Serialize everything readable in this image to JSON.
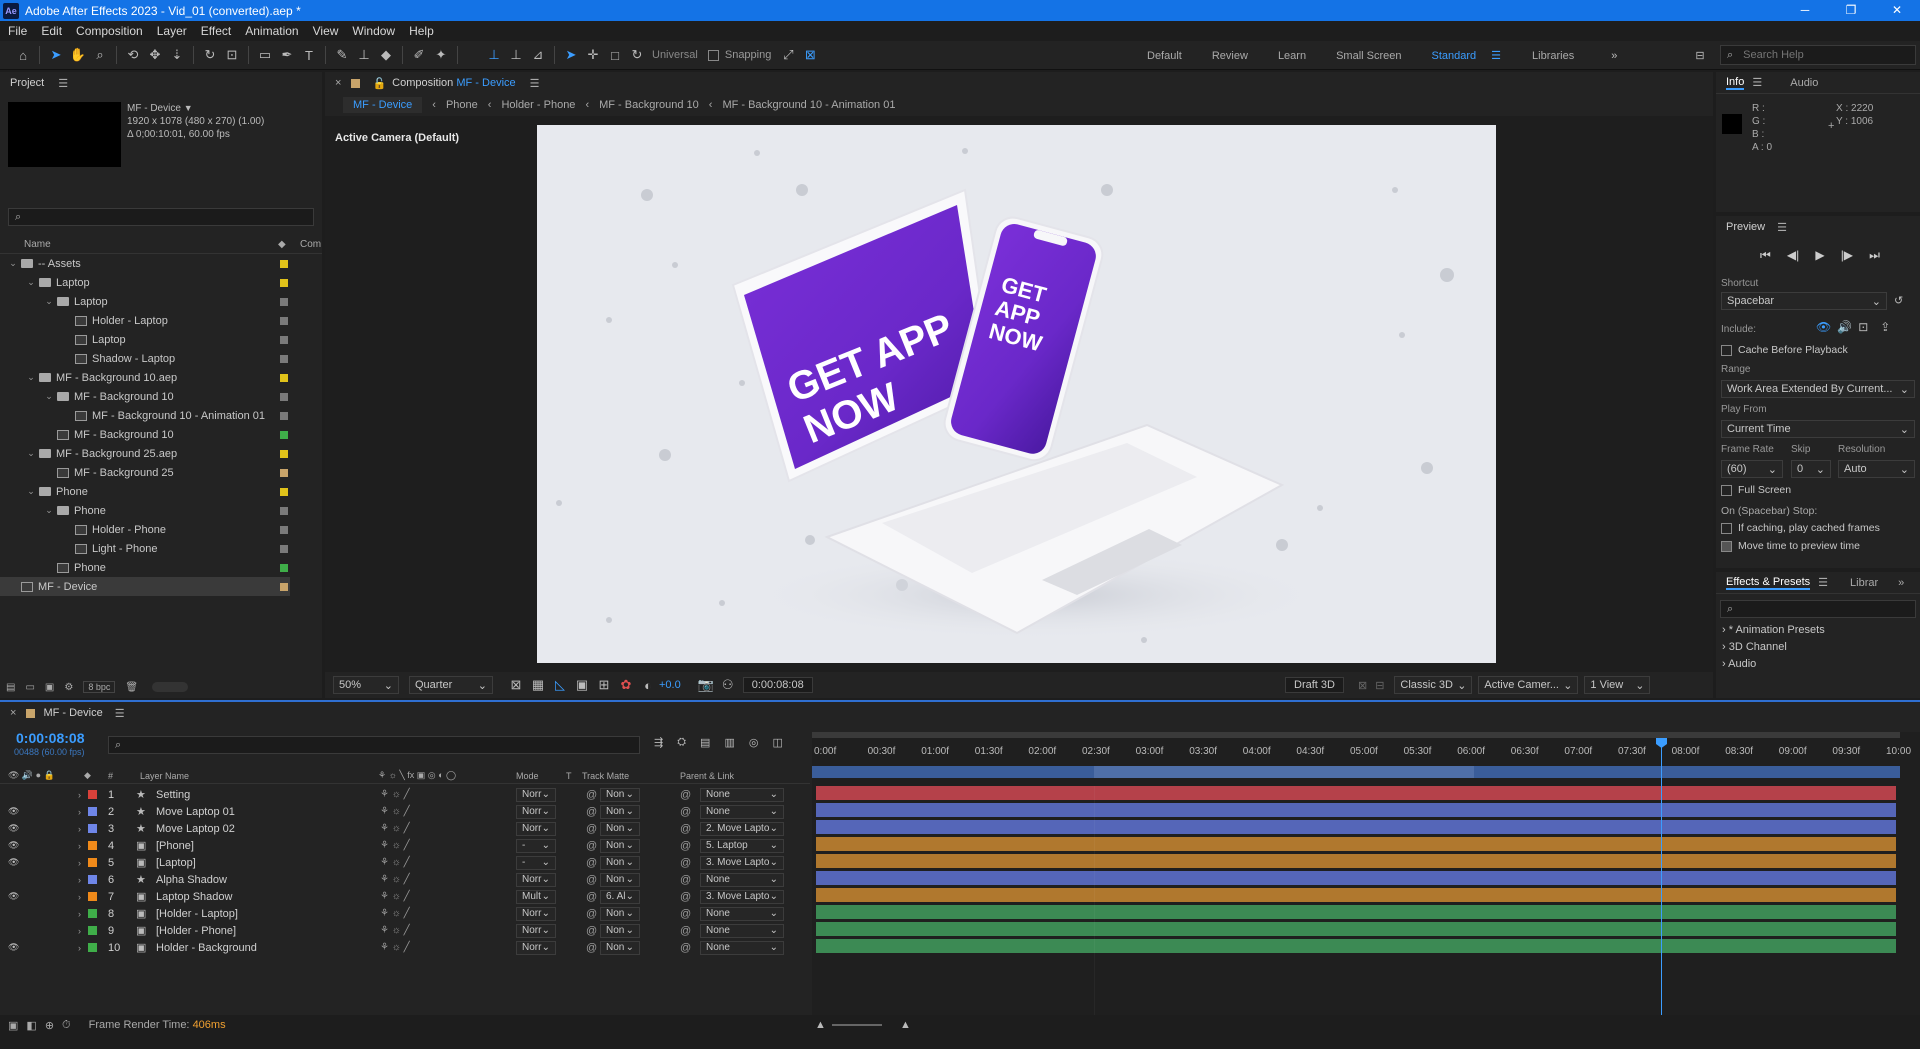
{
  "titlebar": {
    "logo": "Ae",
    "title": "Adobe After Effects 2023 - Vid_01 (converted).aep *",
    "min": "─",
    "max": "❐",
    "close": "✕"
  },
  "menu": [
    "File",
    "Edit",
    "Composition",
    "Layer",
    "Effect",
    "Animation",
    "View",
    "Window",
    "Help"
  ],
  "toolbar": {
    "axis_mode": "Universal",
    "snapping": "Snapping",
    "workspaces": [
      "Default",
      "Review",
      "Learn",
      "Small Screen",
      "Standard",
      "Libraries"
    ],
    "active_workspace": "Standard",
    "search_placeholder": "Search Help"
  },
  "project": {
    "title": "Project",
    "selected_name": "MF - Device",
    "selected_info1": "1920 x 1078  (480 x 270) (1.00)",
    "selected_info2": "Δ 0;00:10:01, 60.00 fps",
    "col_name": "Name",
    "col_comment": "Com",
    "bpc": "8 bpc",
    "items": [
      {
        "name": "-- Assets",
        "level": 0,
        "type": "folder",
        "color": "#e0c21a",
        "open": true
      },
      {
        "name": "Laptop",
        "level": 1,
        "type": "folder",
        "color": "#e0c21a",
        "open": true
      },
      {
        "name": "Laptop",
        "level": 2,
        "type": "folder",
        "color": "#7a7a7a",
        "open": true
      },
      {
        "name": "Holder - Laptop",
        "level": 3,
        "type": "comp",
        "color": "#7a7a7a"
      },
      {
        "name": "Laptop",
        "level": 3,
        "type": "comp",
        "color": "#7a7a7a"
      },
      {
        "name": "Shadow - Laptop",
        "level": 3,
        "type": "comp",
        "color": "#7a7a7a"
      },
      {
        "name": "MF - Background 10.aep",
        "level": 1,
        "type": "folder",
        "color": "#e0c21a",
        "open": true
      },
      {
        "name": "MF - Background 10",
        "level": 2,
        "type": "folder",
        "color": "#7a7a7a",
        "open": true
      },
      {
        "name": "MF - Background 10 - Animation 01",
        "level": 3,
        "type": "comp",
        "color": "#7a7a7a"
      },
      {
        "name": "MF - Background 10",
        "level": 2,
        "type": "comp",
        "color": "#3fae49"
      },
      {
        "name": "MF - Background 25.aep",
        "level": 1,
        "type": "folder",
        "color": "#e0c21a",
        "open": true
      },
      {
        "name": "MF - Background 25",
        "level": 2,
        "type": "comp",
        "color": "#c8a46a"
      },
      {
        "name": "Phone",
        "level": 1,
        "type": "folder",
        "color": "#e0c21a",
        "open": true
      },
      {
        "name": "Phone",
        "level": 2,
        "type": "folder",
        "color": "#7a7a7a",
        "open": true
      },
      {
        "name": "Holder - Phone",
        "level": 3,
        "type": "comp",
        "color": "#7a7a7a"
      },
      {
        "name": "Light - Phone",
        "level": 3,
        "type": "comp",
        "color": "#7a7a7a"
      },
      {
        "name": "Phone",
        "level": 2,
        "type": "comp",
        "color": "#3fae49"
      },
      {
        "name": "MF - Device",
        "level": 0,
        "type": "comp",
        "color": "#c8a46a",
        "selected": true
      }
    ]
  },
  "comp": {
    "tab_prefix": "Composition",
    "tab_name": "MF - Device",
    "breadcrumbs": [
      "MF - Device",
      "Phone",
      "Holder - Phone",
      "MF - Background 10",
      "MF - Background 10 - Animation 01"
    ],
    "camera_label": "Active Camera (Default)",
    "laptop_text": "GET APP NOW",
    "phone_text": "GET APP NOW",
    "zoom": "50%",
    "resolution": "Quarter",
    "exposure": "+0.0",
    "timecode": "0:00:08:08",
    "draft3d": "Draft 3D",
    "renderer": "Classic 3D",
    "camera": "Active Camer...",
    "views": "1 View"
  },
  "info": {
    "tab": "Info",
    "tab2": "Audio",
    "r": "R :",
    "g": "G :",
    "b": "B :",
    "a": "A : 0",
    "x": "X : 2220",
    "y": "Y : 1006"
  },
  "preview": {
    "title": "Preview",
    "shortcut_label": "Shortcut",
    "shortcut": "Spacebar",
    "include_label": "Include:",
    "cache": "Cache Before Playback",
    "range_label": "Range",
    "range": "Work Area Extended By Current...",
    "playfrom_label": "Play From",
    "playfrom": "Current Time",
    "framerate_label": "Frame Rate",
    "skip_label": "Skip",
    "resolution_label": "Resolution",
    "framerate": "(60)",
    "skip": "0",
    "resolution": "Auto",
    "fullscreen": "Full Screen",
    "stop_label": "On (Spacebar) Stop:",
    "if_caching": "If caching, play cached frames",
    "move_time": "Move time to preview time"
  },
  "effects": {
    "title": "Effects & Presets",
    "tab2": "Librar",
    "items": [
      "* Animation Presets",
      "3D Channel",
      "Audio"
    ]
  },
  "timeline": {
    "tab": "MF - Device",
    "timecode": "0:00:08:08",
    "frames": "00488 (60.00 fps)",
    "headers": {
      "num": "#",
      "name": "Layer Name",
      "mode": "Mode",
      "t": "T",
      "matte": "Track Matte",
      "parent": "Parent & Link"
    },
    "ruler": [
      "0:00f",
      "00:30f",
      "01:00f",
      "01:30f",
      "02:00f",
      "02:30f",
      "03:00f",
      "03:30f",
      "04:00f",
      "04:30f",
      "05:00f",
      "05:30f",
      "06:00f",
      "06:30f",
      "07:00f",
      "07:30f",
      "08:00f",
      "08:30f",
      "09:00f",
      "09:30f",
      "10:00"
    ],
    "layers": [
      {
        "num": "1",
        "name": "Setting",
        "label": "#d9413a",
        "icon": "star",
        "mode": "Norr",
        "matte": "Non",
        "parent": "None",
        "bar": "#b5414a",
        "eye": false
      },
      {
        "num": "2",
        "name": "Move Laptop 01",
        "label": "#6f86e8",
        "icon": "star",
        "mode": "Norr",
        "matte": "Non",
        "parent": "None",
        "bar": "#5566b8",
        "eye": true
      },
      {
        "num": "3",
        "name": "Move Laptop 02",
        "label": "#6f86e8",
        "icon": "star",
        "mode": "Norr",
        "matte": "Non",
        "parent": "2. Move Lapto",
        "bar": "#5566b8",
        "eye": true
      },
      {
        "num": "4",
        "name": "[Phone]",
        "label": "#f08a1a",
        "icon": "comp",
        "mode": "-",
        "matte": "Non",
        "parent": "5. Laptop",
        "bar": "#b0782e",
        "eye": true
      },
      {
        "num": "5",
        "name": "[Laptop]",
        "label": "#f08a1a",
        "icon": "comp",
        "mode": "-",
        "matte": "Non",
        "parent": "3. Move Lapto",
        "bar": "#b0782e",
        "eye": true
      },
      {
        "num": "6",
        "name": "Alpha Shadow",
        "label": "#6f86e8",
        "icon": "star",
        "mode": "Norr",
        "matte": "Non",
        "parent": "None",
        "bar": "#5566b8",
        "eye": false
      },
      {
        "num": "7",
        "name": "Laptop Shadow",
        "label": "#f08a1a",
        "icon": "comp",
        "mode": "Mult",
        "matte": "6. Al",
        "parent": "3. Move Lapto",
        "bar": "#b0782e",
        "eye": true
      },
      {
        "num": "8",
        "name": "[Holder - Laptop]",
        "label": "#3fae49",
        "icon": "comp",
        "mode": "Norr",
        "matte": "Non",
        "parent": "None",
        "bar": "#3c8a54",
        "eye": false
      },
      {
        "num": "9",
        "name": "[Holder - Phone]",
        "label": "#3fae49",
        "icon": "comp",
        "mode": "Norr",
        "matte": "Non",
        "parent": "None",
        "bar": "#3c8a54",
        "eye": false
      },
      {
        "num": "10",
        "name": "Holder - Background",
        "label": "#3fae49",
        "icon": "comp",
        "mode": "Norr",
        "matte": "Non",
        "parent": "None",
        "bar": "#3c8a54",
        "eye": true
      }
    ],
    "status_label": "Frame Render Time:",
    "status_value": "406ms"
  },
  "colors": {
    "accent": "#1473e6",
    "purple": "#7b2fd6"
  }
}
